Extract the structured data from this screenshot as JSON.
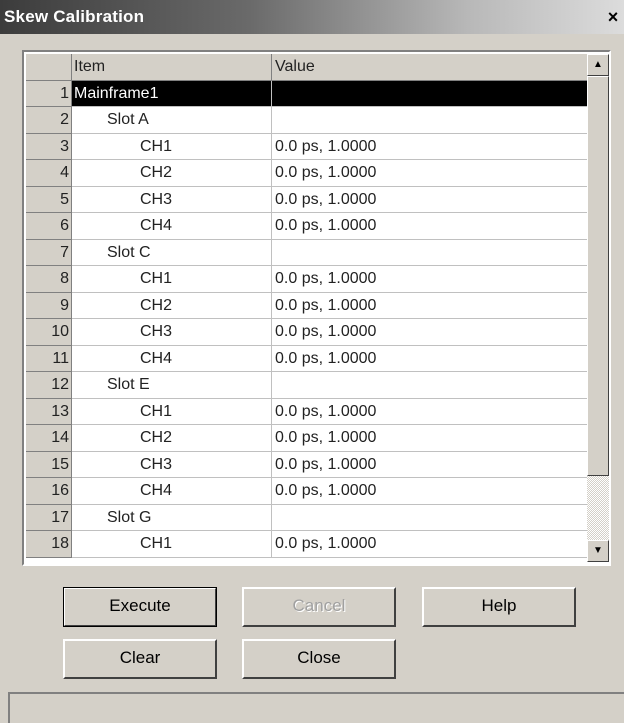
{
  "window": {
    "title": "Skew Calibration",
    "close_glyph": "×"
  },
  "grid": {
    "columns": [
      "Item",
      "Value"
    ],
    "rows": [
      {
        "num": "1",
        "item": "Mainframe1",
        "value": "",
        "indent": 0
      },
      {
        "num": "2",
        "item": "Slot A",
        "value": "",
        "indent": 1
      },
      {
        "num": "3",
        "item": "CH1",
        "value": "0.0 ps, 1.0000",
        "indent": 2
      },
      {
        "num": "4",
        "item": "CH2",
        "value": "0.0 ps, 1.0000",
        "indent": 2
      },
      {
        "num": "5",
        "item": "CH3",
        "value": "0.0 ps, 1.0000",
        "indent": 2
      },
      {
        "num": "6",
        "item": "CH4",
        "value": "0.0 ps, 1.0000",
        "indent": 2
      },
      {
        "num": "7",
        "item": "Slot C",
        "value": "",
        "indent": 1
      },
      {
        "num": "8",
        "item": "CH1",
        "value": "0.0 ps, 1.0000",
        "indent": 2
      },
      {
        "num": "9",
        "item": "CH2",
        "value": "0.0 ps, 1.0000",
        "indent": 2
      },
      {
        "num": "10",
        "item": "CH3",
        "value": "0.0 ps, 1.0000",
        "indent": 2
      },
      {
        "num": "11",
        "item": "CH4",
        "value": "0.0 ps, 1.0000",
        "indent": 2
      },
      {
        "num": "12",
        "item": "Slot E",
        "value": "",
        "indent": 1
      },
      {
        "num": "13",
        "item": "CH1",
        "value": "0.0 ps, 1.0000",
        "indent": 2
      },
      {
        "num": "14",
        "item": "CH2",
        "value": "0.0 ps, 1.0000",
        "indent": 2
      },
      {
        "num": "15",
        "item": "CH3",
        "value": "0.0 ps, 1.0000",
        "indent": 2
      },
      {
        "num": "16",
        "item": "CH4",
        "value": "0.0 ps, 1.0000",
        "indent": 2
      },
      {
        "num": "17",
        "item": "Slot G",
        "value": "",
        "indent": 1
      },
      {
        "num": "18",
        "item": "CH1",
        "value": "0.0 ps, 1.0000",
        "indent": 2
      }
    ],
    "selected_row": 0
  },
  "scrollbar": {
    "up_glyph": "▲",
    "down_glyph": "▼",
    "up_icon": "arrow-up-icon",
    "down_icon": "arrow-down-icon"
  },
  "buttons": {
    "execute": "Execute",
    "cancel": "Cancel",
    "help": "Help",
    "clear": "Clear",
    "close": "Close"
  },
  "status": {
    "text": ""
  },
  "colors": {
    "face": "#d4d0c8",
    "selection": "#000000",
    "title_dark": "#3c3c3c"
  }
}
